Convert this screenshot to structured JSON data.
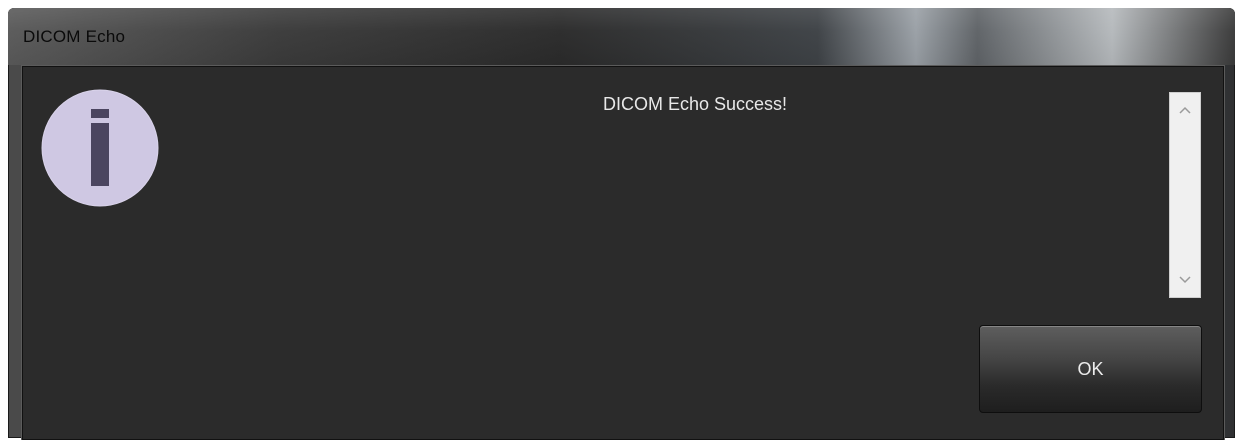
{
  "window": {
    "title": "DICOM Echo"
  },
  "dialog": {
    "message": "DICOM Echo Success!",
    "ok_label": "OK",
    "icon": "info-icon"
  },
  "colors": {
    "client_background": "#2b2b2b",
    "icon_circle": "#cfc8e3",
    "icon_glyph": "#4b4560",
    "message_text": "#e8e8e8"
  }
}
